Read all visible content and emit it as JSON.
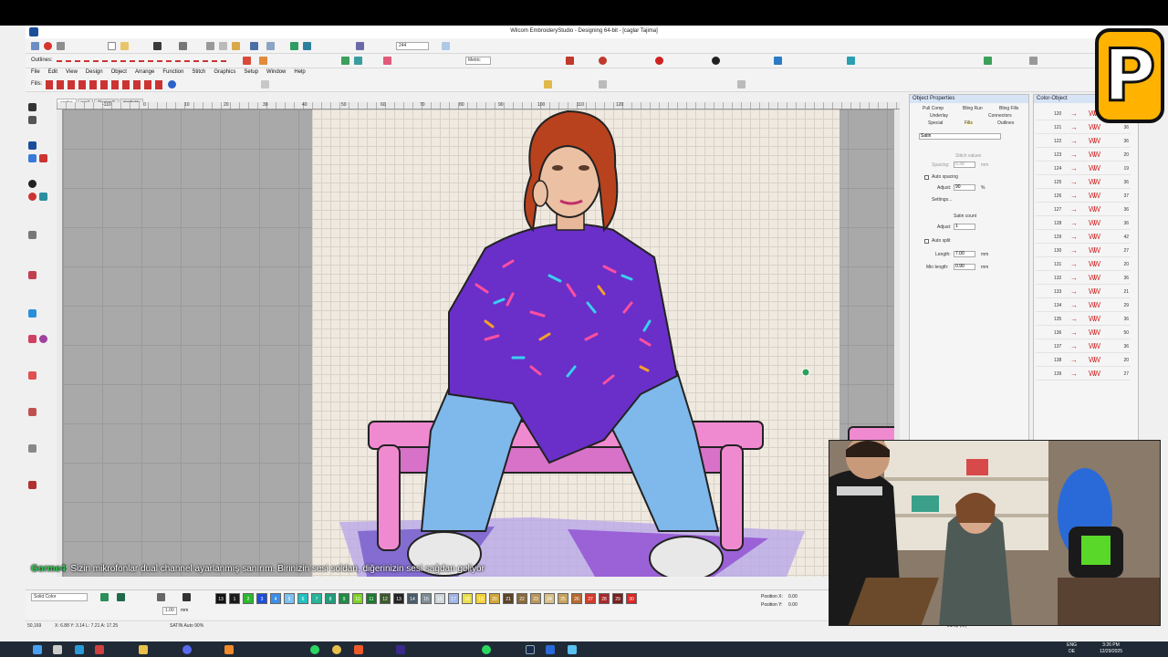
{
  "window": {
    "title": "Wilcom EmbroideryStudio - Designing 64-bit - [caglar      Tajima]"
  },
  "toolbar": {
    "outlines_label": "Outlines:",
    "fills_label": "Fills:",
    "zoom_value": "244",
    "units_value": "Metric"
  },
  "menu": [
    "File",
    "Edit",
    "View",
    "Design",
    "Object",
    "Arrange",
    "Function",
    "Stitch",
    "Graphics",
    "Setup",
    "Window",
    "Help"
  ],
  "tabs": [
    "caglar",
    "ver1",
    "Design2",
    "digifishh"
  ],
  "ruler": {
    "top_ticks": [
      "-110",
      "0",
      "10",
      "20",
      "30",
      "40",
      "50",
      "60",
      "70",
      "80",
      "90",
      "100",
      "110",
      "120"
    ]
  },
  "object_properties": {
    "title": "Object Properties",
    "tabs_row1": [
      "Pull Comp",
      "Bling Run",
      "Bling Fills"
    ],
    "tabs_row2": [
      "Underlay",
      "Connectors"
    ],
    "tabs_row3": [
      "Special",
      "Fills",
      "Outlines"
    ],
    "fill_type": "Satin",
    "stitch_values": "Stitch values",
    "spacing_label": "Spacing:",
    "spacing_value": "0.38",
    "spacing_unit": "mm",
    "auto_spacing": "Auto spacing",
    "adjust_label": "Adjust:",
    "adjust_value": "90",
    "adjust_unit": "%",
    "settings": "Settings...",
    "satin_count": "Satin count",
    "adjust2_label": "Adjust:",
    "adjust2_value": "1",
    "auto_split": "Auto split",
    "length_label": "Length:",
    "length_value": "7.00",
    "length_unit": "mm",
    "minlength_label": "Min length:",
    "minlength_value": "0.90",
    "minlength_unit": "mm"
  },
  "color_object_list": {
    "title": "Color-Object",
    "rows": [
      {
        "num": "120",
        "count": "19"
      },
      {
        "num": "121",
        "count": "36"
      },
      {
        "num": "122",
        "count": "36"
      },
      {
        "num": "123",
        "count": "20"
      },
      {
        "num": "124",
        "count": "19"
      },
      {
        "num": "125",
        "count": "36"
      },
      {
        "num": "126",
        "count": "37"
      },
      {
        "num": "127",
        "count": "36"
      },
      {
        "num": "128",
        "count": "36"
      },
      {
        "num": "129",
        "count": "42"
      },
      {
        "num": "130",
        "count": "27"
      },
      {
        "num": "131",
        "count": "20"
      },
      {
        "num": "132",
        "count": "36"
      },
      {
        "num": "133",
        "count": "21"
      },
      {
        "num": "134",
        "count": "29"
      },
      {
        "num": "135",
        "count": "36"
      },
      {
        "num": "136",
        "count": "50"
      },
      {
        "num": "137",
        "count": "36"
      },
      {
        "num": "138",
        "count": "20"
      },
      {
        "num": "139",
        "count": "27"
      }
    ]
  },
  "caption": {
    "speaker": "Gorme4",
    "text": ": Sizin mikrofonlar dual channel ayarlanmış sanırım. Birinizin sesi soldan, diğerinizin sesi sağdan geliyor"
  },
  "colorbar": {
    "solid_color": "Solid Color",
    "stitch_len": "1.00",
    "stitch_unit": "mm",
    "swatches": [
      {
        "n": "13",
        "color": "#111111"
      },
      {
        "n": "1",
        "color": "#1a1a1a"
      },
      {
        "n": "2",
        "color": "#2db82d"
      },
      {
        "n": "3",
        "color": "#1e4fd8"
      },
      {
        "n": "4",
        "color": "#3b8ee8"
      },
      {
        "n": "5",
        "color": "#7cc0f0"
      },
      {
        "n": "6",
        "color": "#22c2c2"
      },
      {
        "n": "7",
        "color": "#28b49a"
      },
      {
        "n": "8",
        "color": "#1f9d7a"
      },
      {
        "n": "9",
        "color": "#228b45"
      },
      {
        "n": "10",
        "color": "#7ed321"
      },
      {
        "n": "11",
        "color": "#1b7a2e"
      },
      {
        "n": "12",
        "color": "#3c5a2a"
      },
      {
        "n": "13",
        "color": "#222222"
      },
      {
        "n": "14",
        "color": "#4a5c6b"
      },
      {
        "n": "15",
        "color": "#7e8c96"
      },
      {
        "n": "16",
        "color": "#cfd6da"
      },
      {
        "n": "17",
        "color": "#9fb5e8"
      },
      {
        "n": "18",
        "color": "#e8e04a"
      },
      {
        "n": "19",
        "color": "#f3d23a"
      },
      {
        "n": "20",
        "color": "#d1a63a"
      },
      {
        "n": "21",
        "color": "#5a4328"
      },
      {
        "n": "22",
        "color": "#8a6a3a"
      },
      {
        "n": "23",
        "color": "#b8965a"
      },
      {
        "n": "24",
        "color": "#d8c08a"
      },
      {
        "n": "25",
        "color": "#c7a25c"
      },
      {
        "n": "26",
        "color": "#b86a30"
      },
      {
        "n": "27",
        "color": "#d43a2a"
      },
      {
        "n": "28",
        "color": "#a8282a"
      },
      {
        "n": "29",
        "color": "#7a1e1e"
      },
      {
        "n": "30",
        "color": "#e02424"
      }
    ],
    "position_x_label": "Position X:",
    "position_x_value": "0.00",
    "position_y_label": "Position Y:",
    "position_y_value": "0.00"
  },
  "status": {
    "coords": "50,169",
    "xy": "X: 6.88 Y: 3.14 L: 7.21 A: 17.25",
    "mode": "SATIN Auto 90%",
    "jump": "Jump (M)"
  },
  "taskbar": {
    "lang1": "ENG",
    "lang2": "DE",
    "time": "3:26 PM",
    "date": "12/29/2025"
  },
  "colors": {
    "accent": "#1a4e9a",
    "logo_yellow": "#ffb300"
  }
}
